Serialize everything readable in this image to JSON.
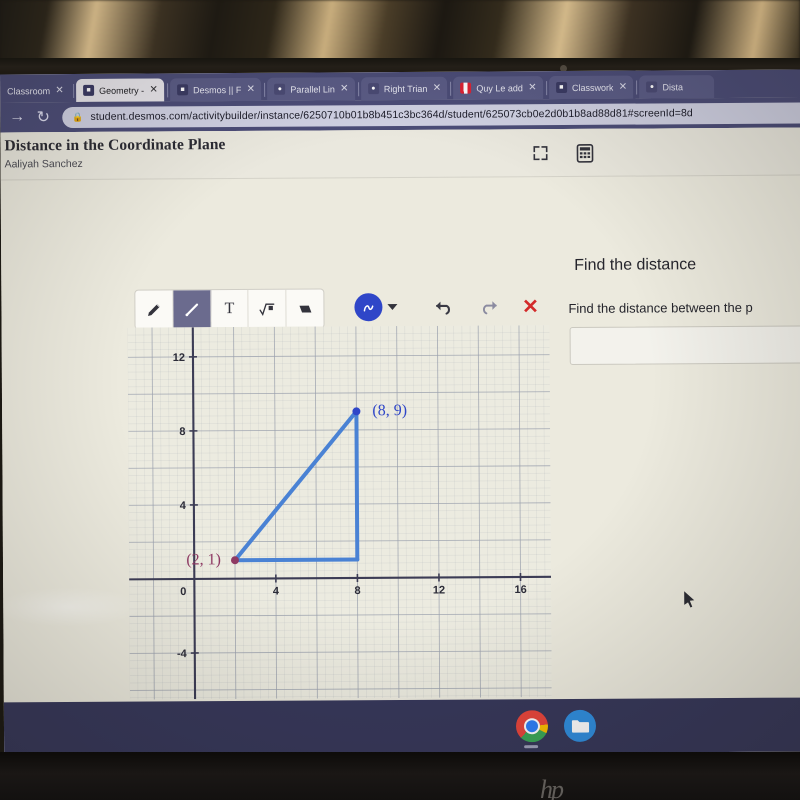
{
  "browser": {
    "tabs": [
      {
        "label": "Classroom",
        "favicon": "none",
        "active": false
      },
      {
        "label": "Geometry -",
        "favicon": "doc-icon",
        "active": true
      },
      {
        "label": "Desmos || F",
        "favicon": "doc-icon",
        "active": false
      },
      {
        "label": "Parallel Lin",
        "favicon": "desmos-icon",
        "active": false
      },
      {
        "label": "Right Trian",
        "favicon": "desmos-icon",
        "active": false
      },
      {
        "label": "Quy Le add",
        "favicon": "flag-icon",
        "active": false
      },
      {
        "label": "Classwork",
        "favicon": "doc-icon",
        "active": false
      },
      {
        "label": "Dista",
        "favicon": "desmos-icon",
        "active": false
      }
    ],
    "close_label": "✕",
    "back_label": "→",
    "reload_label": "↻",
    "lock_label": "🔒",
    "url": "student.desmos.com/activitybuilder/instance/6250710b01b8b451c3bc364d/student/625073cb0e2d0b1b8ad88d81#screenId=8d"
  },
  "activity": {
    "title": "Distance in the Coordinate Plane",
    "student": "Aaliyah Sanchez",
    "expand_icon": "fullscreen-icon",
    "calculator_icon": "calculator-icon"
  },
  "toolbar": {
    "tools": [
      {
        "name": "pencil-tool",
        "glyph": "✎",
        "selected": false
      },
      {
        "name": "line-tool",
        "glyph": "╱",
        "selected": true
      },
      {
        "name": "text-tool",
        "glyph": "T",
        "selected": false
      },
      {
        "name": "math-tool",
        "glyph": "√",
        "selected": false
      },
      {
        "name": "eraser-tool",
        "glyph": "▱",
        "selected": false
      }
    ],
    "color_swatch": "#2f46c8",
    "color_glyph": "∿",
    "undo_glyph": "↶",
    "redo_glyph": "↷",
    "delete_glyph": "✕"
  },
  "question": {
    "heading": "Find the distance",
    "prompt": "Find the distance between the p",
    "answer_value": "",
    "answer_placeholder": ""
  },
  "chart_data": {
    "type": "scatter",
    "title": "",
    "xlabel": "",
    "ylabel": "",
    "xlim": [
      -3.2,
      17.5
    ],
    "ylim": [
      -6.5,
      13.6
    ],
    "x_ticks": [
      0,
      4,
      8,
      12,
      16
    ],
    "y_ticks": [
      -4,
      4,
      8,
      12
    ],
    "grid": true,
    "minor_grid": true,
    "grid_major_step": 2,
    "grid_minor_step": 0.4,
    "origin_label": "0",
    "points": [
      {
        "x": 2,
        "y": 1,
        "label": "(2, 1)",
        "color": "#8f3a63",
        "label_color": "#8f3a63"
      },
      {
        "x": 8,
        "y": 9,
        "label": "(8, 9)",
        "color": "#2f46c8",
        "label_color": "#2f46c8"
      }
    ],
    "segments": [
      {
        "from": [
          2,
          1
        ],
        "to": [
          8,
          9
        ],
        "color": "#4a82d4",
        "width": 4
      },
      {
        "from": [
          8,
          9
        ],
        "to": [
          8,
          1
        ],
        "color": "#4a82d4",
        "width": 4
      },
      {
        "from": [
          8,
          1
        ],
        "to": [
          2,
          1
        ],
        "color": "#4a82d4",
        "width": 4
      }
    ],
    "axis_color": "#3c3c55",
    "grid_color": "#9aa0ad",
    "background": "#ecebe0"
  },
  "shelf": {
    "chrome_icon": "chrome-icon",
    "files_icon": "files-folder-icon"
  },
  "device": {
    "brand": "hp"
  },
  "cursor": {
    "name": "mouse-pointer"
  }
}
